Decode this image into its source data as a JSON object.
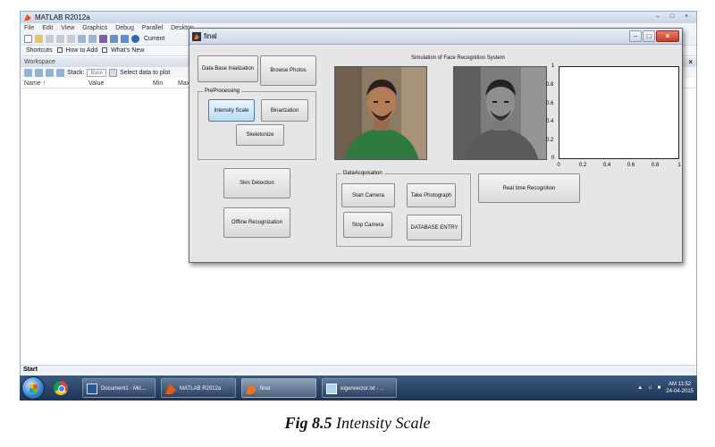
{
  "matlab": {
    "title": "MATLAB R2012a",
    "menu": [
      "File",
      "Edit",
      "View",
      "Graphics",
      "Debug",
      "Parallel",
      "Desktop"
    ],
    "toolbar_current": "Current",
    "shortcuts": {
      "shortcuts": "Shortcuts",
      "how_to_add": "How to Add",
      "whats_new": "What's New"
    },
    "workspace": {
      "title": "Workspace",
      "stack_label": "Stack:",
      "stack_value": "Base",
      "select_data": "Select data to plot",
      "columns": [
        "Name ↑",
        "Value",
        "Min",
        "Max"
      ]
    },
    "start": "Start"
  },
  "figure": {
    "title": "final",
    "buttons": {
      "db_init": "Data Base Inialization",
      "browse": "Browse Photos",
      "intensity": "Intensity Scale",
      "binarization": "Binarization",
      "skeletonize": "Skeletonize",
      "skin": "Skin Detection",
      "offline": "Offline Recognization",
      "start_camera": "Start Camera",
      "take_photo": "Take Photograph",
      "stop_camera": "Stop Camera",
      "db_entry": "DATABASE ENTRY",
      "realtime": "Real time Recognition"
    },
    "panels": {
      "preprocessing": "PreProcessing",
      "acquisition": "DataAcquisation"
    },
    "sim_title": "Simulation of Face Recognition System",
    "axes": {
      "y_ticks": [
        "0",
        "0.2",
        "0.4",
        "0.6",
        "0.8",
        "1"
      ],
      "x_ticks": [
        "0",
        "0.2",
        "0.4",
        "0.6",
        "0.8",
        "1"
      ]
    }
  },
  "taskbar": {
    "tasks": [
      "Document1 - Mic...",
      "MATLAB R2012a",
      "final",
      "eigenvector.txt - ..."
    ],
    "time": "AM 11:52",
    "date": "24-04-2015"
  },
  "caption": {
    "label": "Fig 8.5",
    "text": "Intensity Scale"
  },
  "colors": {
    "active_button": "#b7dcf5",
    "taskbar": "#1c3457"
  }
}
